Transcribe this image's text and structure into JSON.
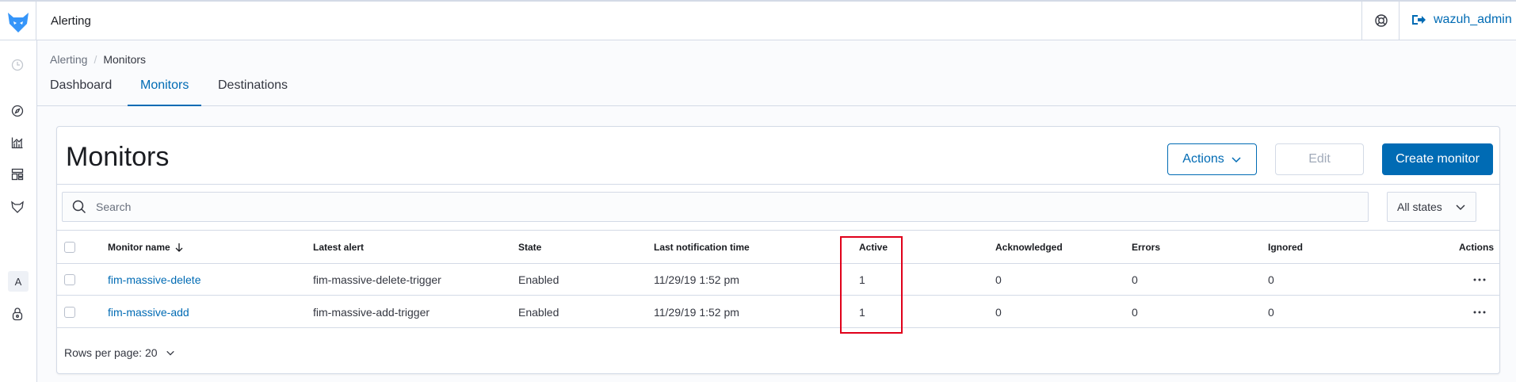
{
  "header": {
    "app_title": "Alerting",
    "user": "wazuh_admin",
    "icons": [
      "wazuh-logo-icon",
      "help-icon",
      "logout-icon"
    ]
  },
  "sidenav": {
    "icons": [
      "clock-icon",
      "compass-icon",
      "visualize-icon",
      "dashboard-icon",
      "wazuh-icon",
      "lock-icon"
    ],
    "badge": "A"
  },
  "breadcrumb": {
    "parent": "Alerting",
    "current": "Monitors"
  },
  "tabs": [
    {
      "label": "Dashboard",
      "active": false
    },
    {
      "label": "Monitors",
      "active": true
    },
    {
      "label": "Destinations",
      "active": false
    }
  ],
  "panel": {
    "title": "Monitors",
    "actions_label": "Actions",
    "edit_label": "Edit",
    "create_label": "Create monitor",
    "search_placeholder": "Search",
    "states_label": "All states"
  },
  "table": {
    "columns": [
      "Monitor name",
      "Latest alert",
      "State",
      "Last notification time",
      "Active",
      "Acknowledged",
      "Errors",
      "Ignored",
      "Actions"
    ],
    "rows": [
      {
        "name": "fim-massive-delete",
        "latest_alert": "fim-massive-delete-trigger",
        "state": "Enabled",
        "last_notification": "11/29/19 1:52 pm",
        "active": "1",
        "acknowledged": "0",
        "errors": "0",
        "ignored": "0"
      },
      {
        "name": "fim-massive-add",
        "latest_alert": "fim-massive-add-trigger",
        "state": "Enabled",
        "last_notification": "11/29/19 1:52 pm",
        "active": "1",
        "acknowledged": "0",
        "errors": "0",
        "ignored": "0"
      }
    ]
  },
  "pager": {
    "label": "Rows per page: 20"
  },
  "colors": {
    "accent": "#006bb4",
    "highlight": "#e0001a"
  }
}
